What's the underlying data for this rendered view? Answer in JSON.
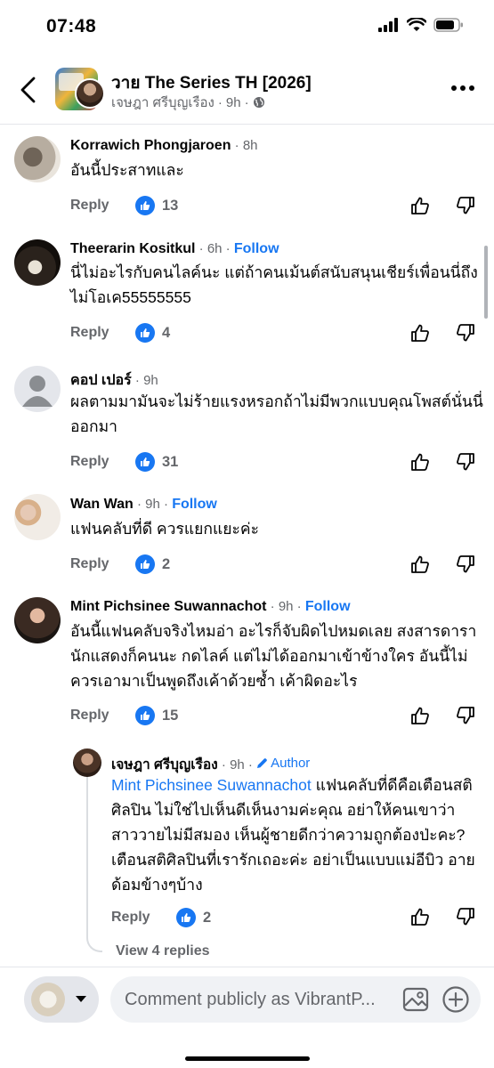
{
  "status_bar": {
    "time": "07:48"
  },
  "header": {
    "title": "วาย The Series TH [2026]",
    "poster": "เจษฎา ศรีบุญเรือง",
    "time": "9h"
  },
  "comments": [
    {
      "name": "Korrawich Phongjaroen",
      "time": "8h",
      "follow": "",
      "text": "อันนี้ประสาทและ",
      "reply": "Reply",
      "likes": "13"
    },
    {
      "name": "Theerarin Kositkul",
      "time": "6h",
      "follow": "Follow",
      "text": "นี่ไม่อะไรกับคนไลค์นะ แต่ถ้าคนเม้นต์สนับสนุนเชียร์เพื่อนนี่ถึงไม่โอเค55555555",
      "reply": "Reply",
      "likes": "4"
    },
    {
      "name": "คอป เปอร์",
      "time": "9h",
      "follow": "",
      "text": "ผลตามมามันจะไม่ร้ายแรงหรอกถ้าไม่มีพวกแบบคุณโพสต์นั่นนี่ออกมา",
      "reply": "Reply",
      "likes": "31"
    },
    {
      "name": "Wan Wan",
      "time": "9h",
      "follow": "Follow",
      "text": "แฟนคลับที่ดี ควรแยกแยะค่ะ",
      "reply": "Reply",
      "likes": "2"
    },
    {
      "name": "Mint Pichsinee Suwannachot",
      "time": "9h",
      "follow": "Follow",
      "text": "อันนี้แฟนคลับจริงไหมอ่า อะไรก็จับผิดไปหมดเลย สงสารดารานักแสดงก็คนนะ กดไลค์ แต่ไม่ได้ออกมาเข้าข้างใคร อันนี้ไม่ควรเอามาเป็นพูดถึงเค้าด้วยซ้ำ เค้าผิดอะไร",
      "reply": "Reply",
      "likes": "15"
    }
  ],
  "reply": {
    "name": "เจษฎา ศรีบุญเรือง",
    "time": "9h",
    "badge": "Author",
    "mention": "Mint Pichsinee Suwannachot",
    "text": " แฟนคลับที่ดีคือเตือนสติศิลปิน ไม่ใช่ไปเห็นดีเห็นงามค่ะคุณ อย่าให้คนเขาว่าสาววายไม่มีสมอง เห็นผู้ชายดีกว่าความถูกต้องป่ะคะ? เตือนสติศิลปินที่เรารักเถอะค่ะ อย่าเป็นแบบแม่อีบิว อายด้อมข้างๆบ้าง",
    "reply": "Reply",
    "likes": "2"
  },
  "view_replies": "View 4 replies",
  "composer": {
    "placeholder": "Comment publicly as VibrantP..."
  },
  "icons": [
    "back-icon",
    "globe-icon",
    "more-icon",
    "like-icon",
    "thumbs-up-outline-icon",
    "thumbs-down-outline-icon",
    "pencil-icon",
    "photo-icon",
    "plus-circle-icon",
    "chevron-down-icon"
  ],
  "colors": {
    "accent": "#1877f2",
    "secondary_text": "#65676b",
    "divider": "#e4e6eb"
  }
}
